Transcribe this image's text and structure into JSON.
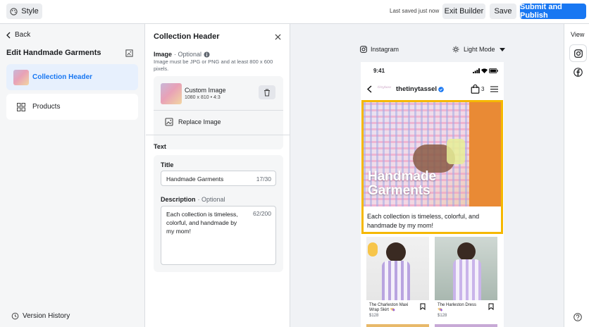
{
  "topbar": {
    "style_label": "Style",
    "saved_status": "Last saved just now",
    "exit_label": "Exit Builder",
    "save_label": "Save",
    "publish_label": "Submit and Publish"
  },
  "left": {
    "back_label": "Back",
    "title": "Edit Handmade Garments",
    "items": [
      {
        "label": "Collection Header",
        "active": true
      },
      {
        "label": "Products",
        "active": false
      }
    ],
    "version_history": "Version History"
  },
  "editor": {
    "header": "Collection Header",
    "image_label": "Image",
    "image_optional": "· Optional",
    "image_hint": "Image must be JPG or PNG and at least 800 x 600 pixels.",
    "file_name": "Custom Image",
    "file_meta": "1080 x 810 • 4:3",
    "replace_label": "Replace Image",
    "text_section": "Text",
    "title_label": "Title",
    "title_value": "Handmade Garments",
    "title_count": "17/30",
    "desc_label": "Description",
    "desc_optional": "· Optional",
    "desc_value": "Each collection is timeless, colorful, and handmade by my mom!",
    "desc_count": "62/200"
  },
  "preview": {
    "platform": "Instagram",
    "mode": "Light Mode",
    "phone": {
      "time": "9:41",
      "username": "thetinytassel",
      "cart_count": "3",
      "hero_title_line1": "Handmade",
      "hero_title_line2": "Garments",
      "hero_desc": "Each collection is timeless, colorful, and handmade by my mom!",
      "products": [
        {
          "name": "The Charleston Maxi Wrap Skirt 👒",
          "price": "$128"
        },
        {
          "name": "The Harleston Dress 👒",
          "price": "$128"
        }
      ]
    }
  },
  "rail": {
    "view_label": "View"
  },
  "colors": {
    "accent": "#1877f2",
    "highlight": "#f5b800",
    "active_bg": "#e7f0fd"
  }
}
